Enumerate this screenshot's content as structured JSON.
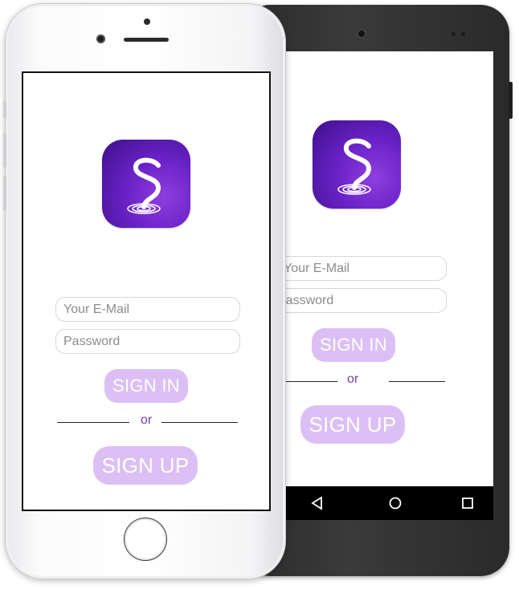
{
  "login": {
    "email_placeholder": "Your E-Mail",
    "password_placeholder": "Password",
    "sign_in_label": "SIGN IN",
    "divider_text": "or",
    "sign_up_label": "SIGN UP"
  },
  "android_login": {
    "email_placeholder": "Your E-Mail",
    "password_placeholder": "Password",
    "sign_in_label": "SIGN IN",
    "divider_text": "or",
    "sign_up_label": "SIGN UP"
  },
  "android_nav": {
    "icons": [
      "back-triangle-icon",
      "home-circle-icon",
      "recents-square-icon"
    ]
  },
  "app_icon": {
    "name": "stylized-s-logo-icon"
  },
  "colors": {
    "icon_dark": "#3d0f8a",
    "icon_light": "#8e3fe0",
    "button_fill": "#dcc0f5",
    "button_text": "#ffffff",
    "divider_text": "#7a3aa8"
  }
}
